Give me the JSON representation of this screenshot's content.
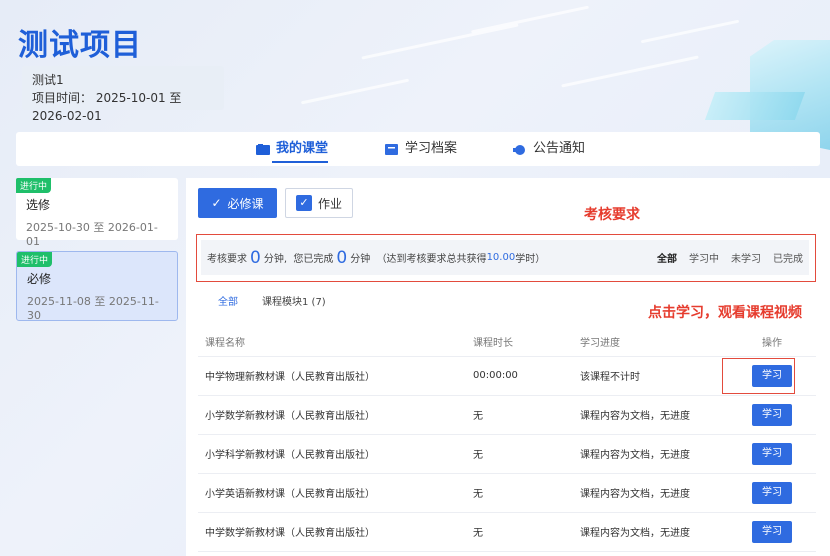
{
  "header": {
    "title": "测试项目",
    "project_name": "测试1",
    "project_time_label": "项目时间：",
    "project_time": "2025-10-01 至2026-02-01"
  },
  "tabs": [
    {
      "label": "我的课堂",
      "icon": "classroom-icon",
      "active": true
    },
    {
      "label": "学习档案",
      "icon": "archive-icon",
      "active": false
    },
    {
      "label": "公告通知",
      "icon": "notice-icon",
      "active": false
    }
  ],
  "sidebar": {
    "cards": [
      {
        "badge": "进行中",
        "name": "选修",
        "date": "2025-10-30 至 2026-01-01",
        "selected": false
      },
      {
        "badge": "进行中",
        "name": "必修",
        "date": "2025-11-08 至 2025-11-30",
        "selected": true
      }
    ]
  },
  "main": {
    "type_buttons": {
      "required": "必修课",
      "homework": "作业"
    },
    "annotation_requirement": "考核要求",
    "requirement": {
      "label": "考核要求",
      "required_minutes": "0",
      "unit1": "分钟,",
      "done_label": "您已完成",
      "done_minutes": "0",
      "unit2": "分钟",
      "note_prefix": "（达到考核要求总共获得",
      "note_hours": "10.00",
      "note_suffix": "学时）"
    },
    "filters": [
      "全部",
      "学习中",
      "未学习",
      "已完成"
    ],
    "sub_tabs": [
      "全部",
      "课程模块1 (7)"
    ],
    "annotation_study": "点击学习，观看课程视频",
    "table": {
      "headers": [
        "课程名称",
        "课程时长",
        "学习进度",
        "操作"
      ],
      "rows": [
        {
          "name": "中学物理新教材课（人民教育出版社）",
          "duration": "00:00:00",
          "progress": "该课程不计时",
          "action": "学习"
        },
        {
          "name": "小学数学新教材课（人民教育出版社）",
          "duration": "无",
          "progress": "课程内容为文档，无进度",
          "action": "学习"
        },
        {
          "name": "小学科学新教材课（人民教育出版社）",
          "duration": "无",
          "progress": "课程内容为文档，无进度",
          "action": "学习"
        },
        {
          "name": "小学英语新教材课（人民教育出版社）",
          "duration": "无",
          "progress": "课程内容为文档，无进度",
          "action": "学习"
        },
        {
          "name": "中学数学新教材课（人民教育出版社）",
          "duration": "无",
          "progress": "课程内容为文档，无进度",
          "action": "学习"
        }
      ]
    }
  },
  "colors": {
    "primary": "#2f6be0",
    "title": "#1f5fd8",
    "badge": "#1fbf6a",
    "annotation": "#e63c2e"
  }
}
